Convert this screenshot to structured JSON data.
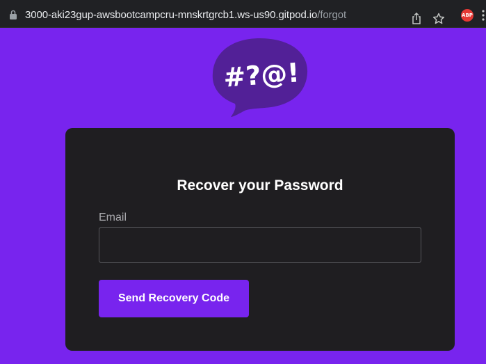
{
  "browser": {
    "url_host": "3000-aki23gup-awsbootcampcru-mnskrtgrcb1.ws-us90.gitpod.io",
    "url_path": "/forgot",
    "abp_label": "ABP",
    "icons": [
      "lock-icon",
      "share-icon",
      "star-icon",
      "adblock-plus-icon",
      "menu-icon"
    ]
  },
  "logo": {
    "text": "#?@!",
    "bubble_color": "#522097"
  },
  "form": {
    "title": "Recover your Password",
    "email_label": "Email",
    "email_value": "",
    "submit_label": "Send Recovery Code"
  },
  "colors": {
    "background": "#7824ee",
    "card": "#1f1e21",
    "button": "#7824ee"
  }
}
